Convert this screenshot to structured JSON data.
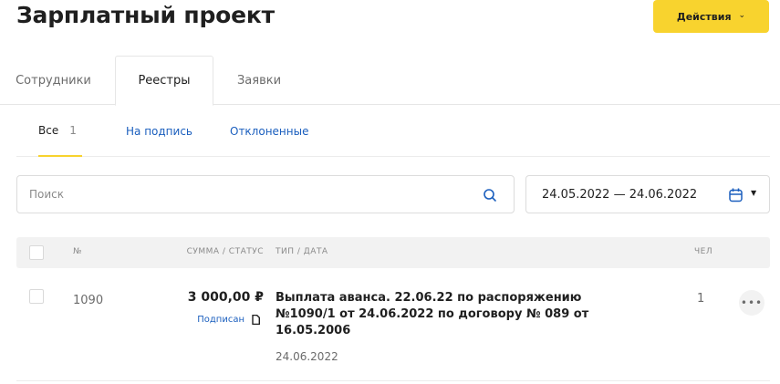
{
  "page": {
    "title": "Зарплатный проект"
  },
  "actions": {
    "label": "Действия"
  },
  "tabs": [
    {
      "label": "Сотрудники",
      "active": false
    },
    {
      "label": "Реестры",
      "active": true
    },
    {
      "label": "Заявки",
      "active": false
    }
  ],
  "subtabs": [
    {
      "label": "Все",
      "count": "1",
      "active": true
    },
    {
      "label": "На подпись",
      "active": false
    },
    {
      "label": "Отклоненные",
      "active": false
    }
  ],
  "search": {
    "placeholder": "Поиск",
    "value": ""
  },
  "date_range": {
    "value": "24.05.2022 — 24.06.2022"
  },
  "table": {
    "columns": {
      "number": "№",
      "sum_status": "СУММА / СТАТУС",
      "type_date": "ТИП / ДАТА",
      "people": "ЧЕЛ"
    },
    "rows": [
      {
        "number": "1090",
        "sum": "3 000,00 ₽",
        "status": "Подписан",
        "description": "Выплата аванса. 22.06.22 по распоряжению №1090/1 от 24.06.2022 по договору № 089 от 16.05.2006",
        "date": "24.06.2022",
        "people": "1"
      }
    ]
  },
  "colors": {
    "accent": "#f8d32e",
    "link": "#1b5fbe",
    "header_bg": "#f2f2f2",
    "text": "#1f1f1f",
    "muted": "#8a8a8a"
  },
  "icons": [
    "chevron-down-icon",
    "search-icon",
    "calendar-icon",
    "caret-down-icon",
    "document-icon",
    "more-icon"
  ]
}
